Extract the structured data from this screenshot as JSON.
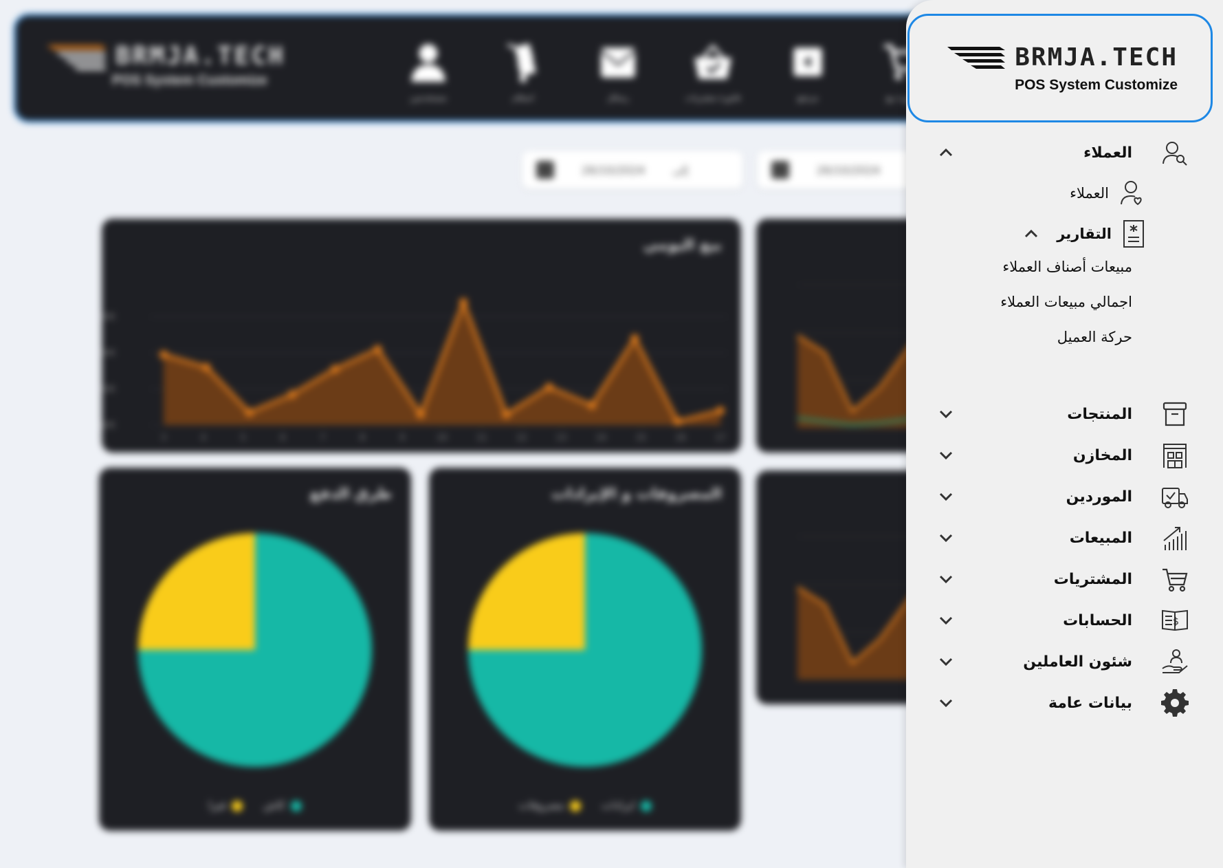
{
  "brand": {
    "name": "BRMJA.TECH",
    "tagline": "POS System Customize"
  },
  "topbar": {
    "icons": [
      {
        "name": "user-icon",
        "label": "مستخدمين"
      },
      {
        "name": "trolley-icon",
        "label": "استلام"
      },
      {
        "name": "mail-icon",
        "label": "رسائل"
      },
      {
        "name": "basket-icon",
        "label": "فاتورة مشتريات"
      },
      {
        "name": "return-icon",
        "label": "مرتجع"
      },
      {
        "name": "cart-icon",
        "label": "فاتورة بيع"
      }
    ]
  },
  "filters": {
    "date_from": "26/10/2024",
    "date_from_label": "إلى",
    "date_to": "26/10/2024"
  },
  "charts_text": {
    "daily_title": "بيع اليومي",
    "payment_title": "طرق الدفع",
    "payment_legend": [
      "كاش",
      "فيزا"
    ],
    "expenses_title": "المصروفات و الإيرادات",
    "expenses_legend": [
      "ايرادات",
      "مصروفات"
    ]
  },
  "chart_data": [
    {
      "type": "area",
      "title": "بيع اليومي",
      "categories": [
        "3",
        "4",
        "5",
        "6",
        "7",
        "8",
        "9",
        "10",
        "11",
        "12",
        "13",
        "14",
        "15",
        "16",
        "17"
      ],
      "values": [
        195,
        160,
        35,
        85,
        155,
        210,
        30,
        340,
        30,
        105,
        55,
        240,
        10,
        40
      ],
      "ylim": [
        0,
        400
      ],
      "yticks": [
        "$0K",
        "$100K",
        "$200K",
        "$300K"
      ],
      "color": "#e07b1a"
    },
    {
      "type": "pie",
      "title": "طرق الدفع",
      "labels": [
        "كاش",
        "فيزا"
      ],
      "values": [
        75,
        25
      ],
      "colors": [
        "#16b8a6",
        "#f9cc1a"
      ]
    },
    {
      "type": "pie",
      "title": "المصروفات و الإيرادات",
      "labels": [
        "ايرادات",
        "مصروفات"
      ],
      "values": [
        75,
        25
      ],
      "colors": [
        "#16b8a6",
        "#f9cc1a"
      ]
    }
  ],
  "sidebar": {
    "customers": {
      "label": "العملاء",
      "sub_customers": "العملاء",
      "reports": {
        "label": "التقارير",
        "items": [
          "مبيعات أصناف العملاء",
          "اجمالي مبيعات العملاء",
          "حركة العميل"
        ]
      }
    },
    "menu": [
      {
        "key": "products",
        "label": "المنتجات",
        "icon": "archive-box-icon"
      },
      {
        "key": "warehouses",
        "label": "المخازن",
        "icon": "warehouse-icon"
      },
      {
        "key": "suppliers",
        "label": "الموردين",
        "icon": "delivery-truck-icon"
      },
      {
        "key": "sales",
        "label": "المبيعات",
        "icon": "sales-growth-icon"
      },
      {
        "key": "purchases",
        "label": "المشتريات",
        "icon": "shopping-cart-icon"
      },
      {
        "key": "accounts",
        "label": "الحسابات",
        "icon": "ledger-book-icon"
      },
      {
        "key": "hr",
        "label": "شئون العاملين",
        "icon": "employee-care-icon"
      },
      {
        "key": "general",
        "label": "بيانات عامة",
        "icon": "gear-icon"
      }
    ]
  }
}
